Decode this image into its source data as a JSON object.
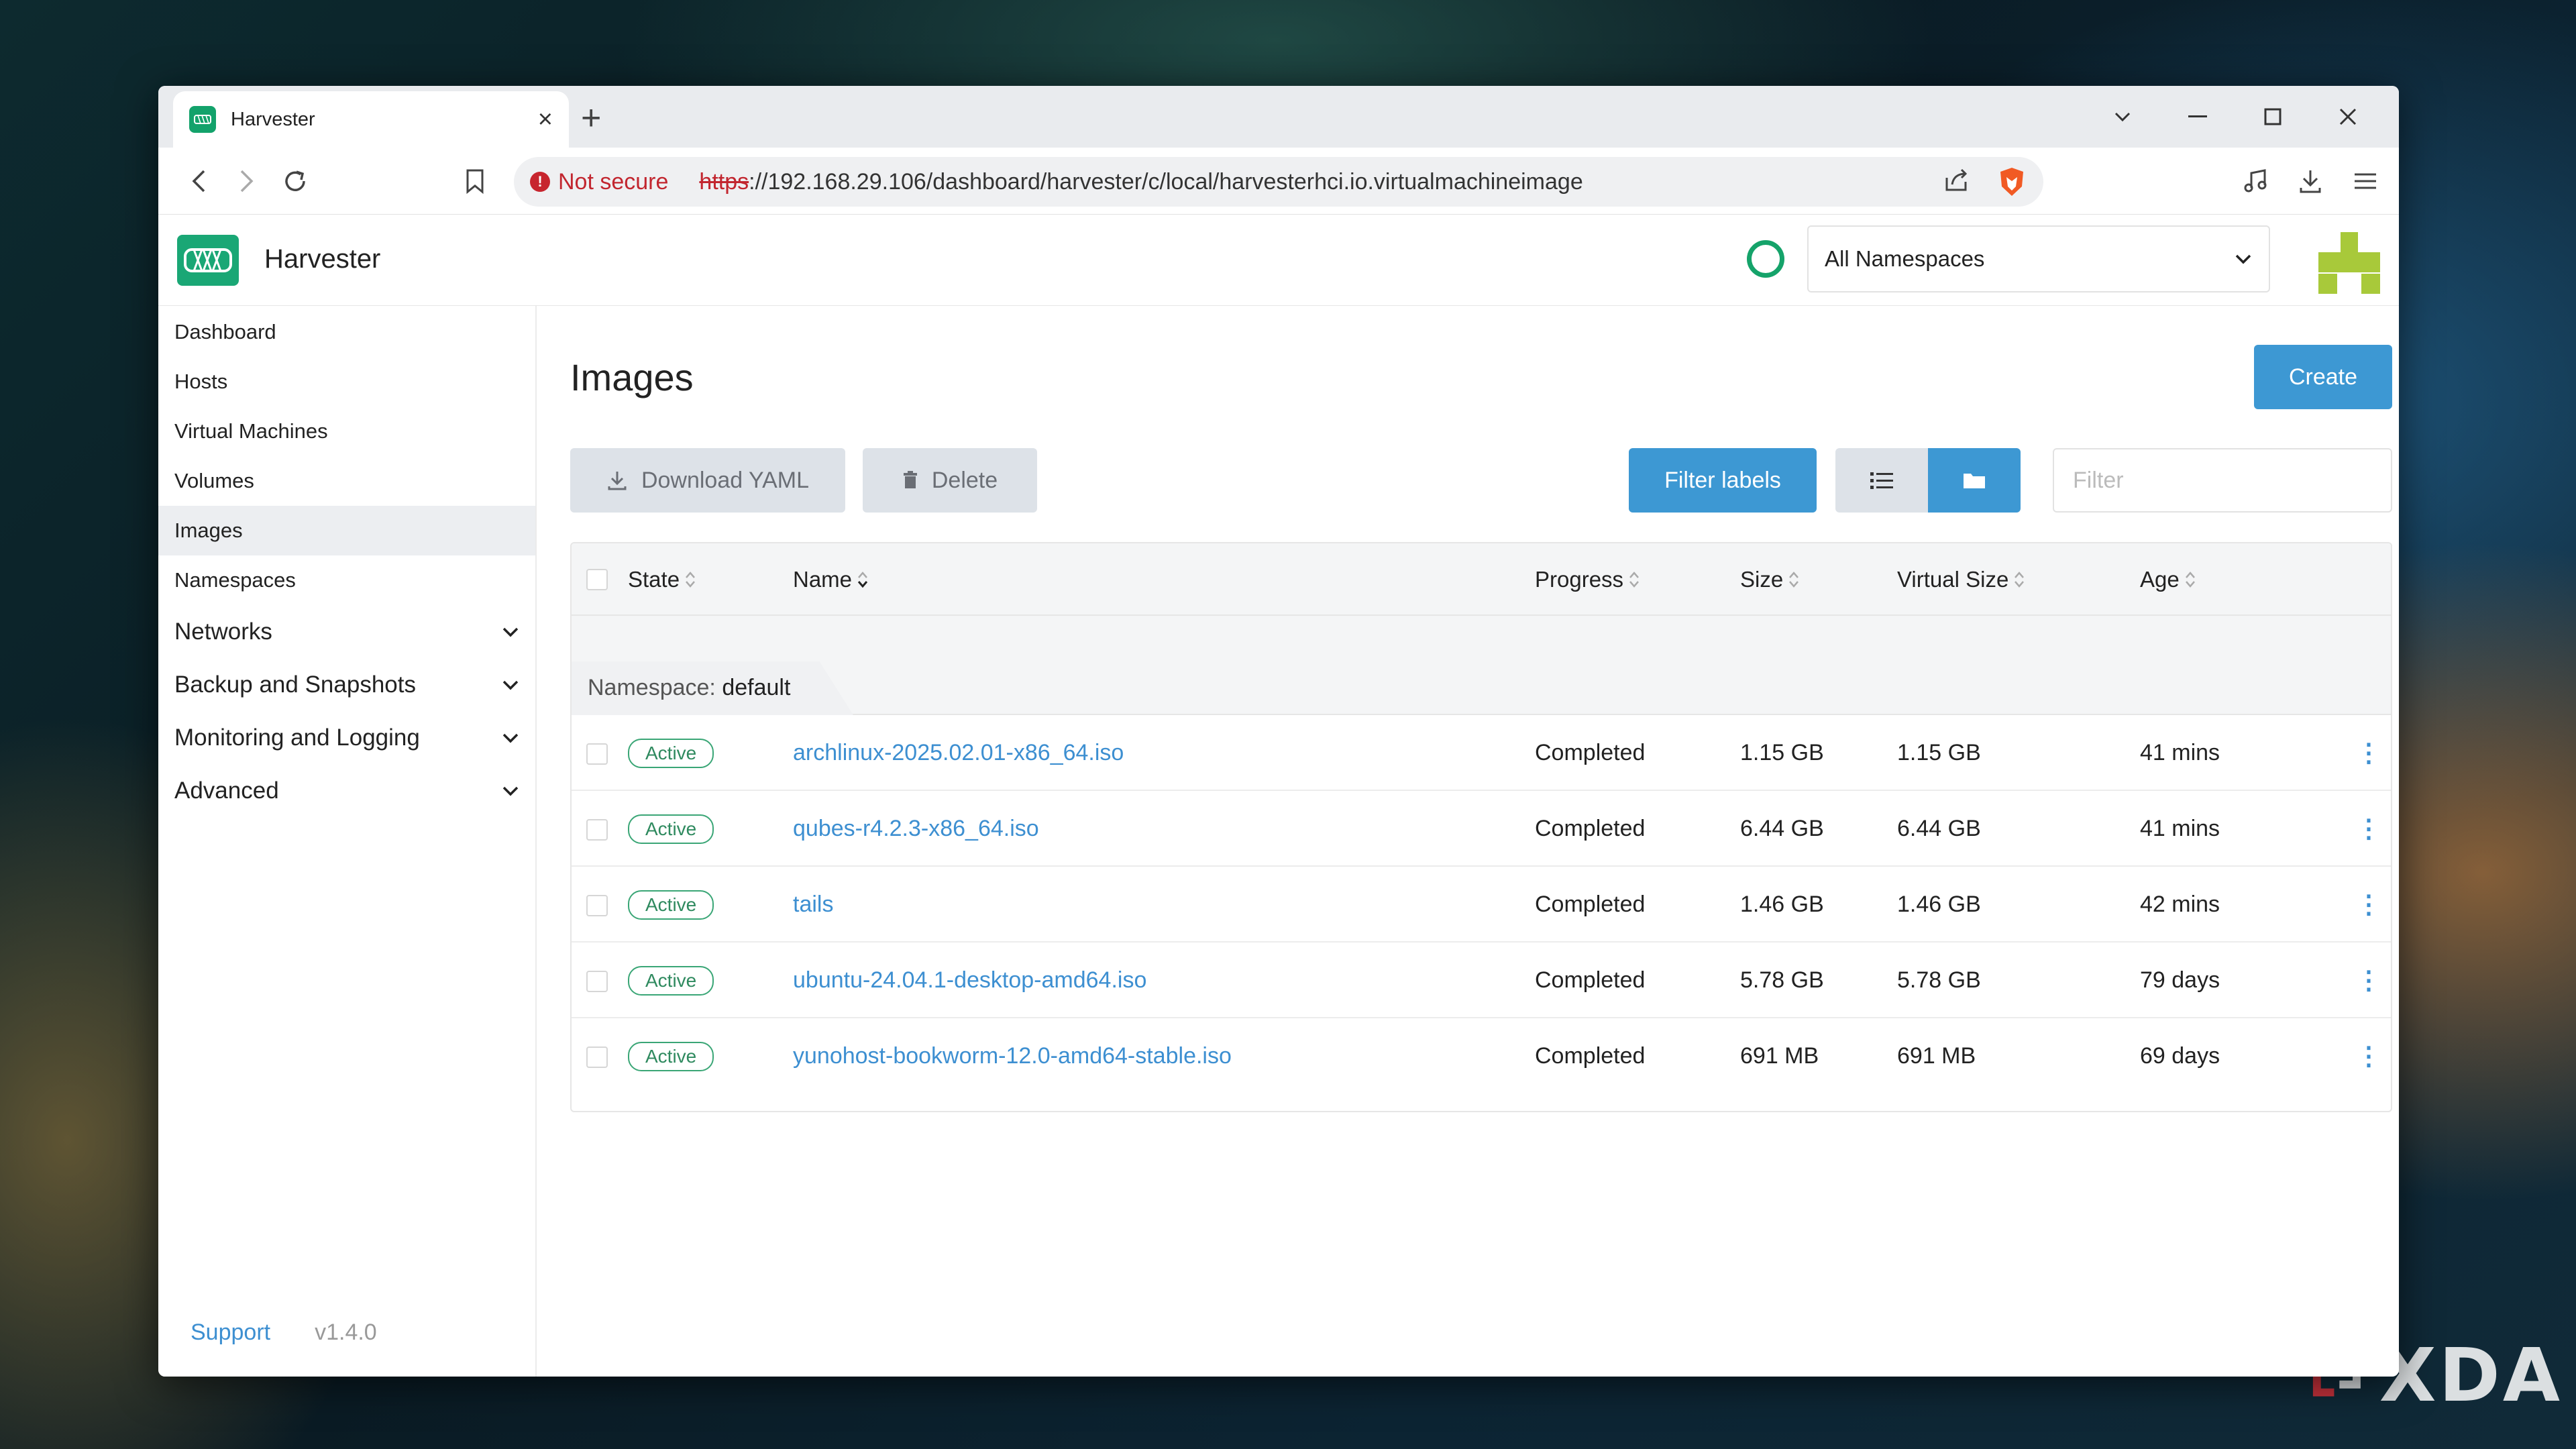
{
  "browser": {
    "tab_title": "Harvester",
    "new_tab": "+",
    "not_secure": "Not secure",
    "url_scheme": "https",
    "url_rest": "://192.168.29.106/dashboard/harvester/c/local/harvesterhci.io.virtualmachineimage"
  },
  "header": {
    "app_title": "Harvester",
    "namespace_select": "All Namespaces"
  },
  "sidebar": {
    "items": [
      {
        "label": "Dashboard"
      },
      {
        "label": "Hosts"
      },
      {
        "label": "Virtual Machines"
      },
      {
        "label": "Volumes"
      },
      {
        "label": "Images"
      },
      {
        "label": "Namespaces"
      }
    ],
    "groups": [
      {
        "label": "Networks"
      },
      {
        "label": "Backup and Snapshots"
      },
      {
        "label": "Monitoring and Logging"
      },
      {
        "label": "Advanced"
      }
    ],
    "support": "Support",
    "version": "v1.4.0"
  },
  "main": {
    "title": "Images",
    "create": "Create",
    "download_yaml": "Download YAML",
    "delete": "Delete",
    "filter_labels": "Filter labels",
    "filter_placeholder": "Filter",
    "columns": {
      "state": "State",
      "name": "Name",
      "progress": "Progress",
      "size": "Size",
      "virtual_size": "Virtual Size",
      "age": "Age"
    },
    "group_prefix": "Namespace:",
    "group_name": "default",
    "rows": [
      {
        "state": "Active",
        "name": "archlinux-2025.02.01-x86_64.iso",
        "progress": "Completed",
        "size": "1.15 GB",
        "virtual_size": "1.15 GB",
        "age": "41 mins"
      },
      {
        "state": "Active",
        "name": "qubes-r4.2.3-x86_64.iso",
        "progress": "Completed",
        "size": "6.44 GB",
        "virtual_size": "6.44 GB",
        "age": "41 mins"
      },
      {
        "state": "Active",
        "name": "tails",
        "progress": "Completed",
        "size": "1.46 GB",
        "virtual_size": "1.46 GB",
        "age": "42 mins"
      },
      {
        "state": "Active",
        "name": "ubuntu-24.04.1-desktop-amd64.iso",
        "progress": "Completed",
        "size": "5.78 GB",
        "virtual_size": "5.78 GB",
        "age": "79 days"
      },
      {
        "state": "Active",
        "name": "yunohost-bookworm-12.0-amd64-stable.iso",
        "progress": "Completed",
        "size": "691 MB",
        "virtual_size": "691 MB",
        "age": "69 days"
      }
    ]
  },
  "watermark": "XDA",
  "colors": {
    "accent": "#3d98d3",
    "brand_green": "#1aa775",
    "active_badge": "#3aa676",
    "not_secure_red": "#c2262f"
  }
}
